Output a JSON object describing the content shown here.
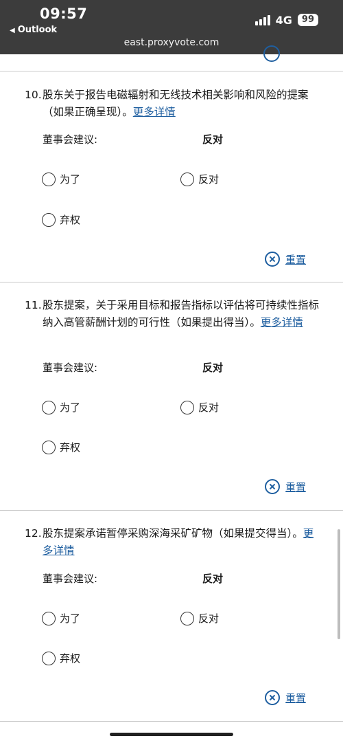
{
  "status": {
    "time": "09:57",
    "back_app": "Outlook",
    "network": "4G",
    "battery": "99",
    "url": "east.proxyvote.com"
  },
  "questions": [
    {
      "number": "10.",
      "text": "股东关于报告电磁辐射和无线技术相关影响和风险的提案（如果正确呈现）。",
      "more": "更多详情",
      "rec_label": "董事会建议:",
      "rec_value": "反对",
      "opt_for": "为了",
      "opt_against": "反对",
      "opt_abstain": "弃权",
      "reset": "重置"
    },
    {
      "number": "11.",
      "text": "股东提案，关于采用目标和报告指标以评估将可持续性指标纳入高管薪酬计划的可行性（如果提出得当）。",
      "more": "更多详情",
      "rec_label": "董事会建议:",
      "rec_value": "反对",
      "opt_for": "为了",
      "opt_against": "反对",
      "opt_abstain": "弃权",
      "reset": "重置"
    },
    {
      "number": "12.",
      "text": "股东提案承诺暂停采购深海采矿矿物（如果提交得当）。",
      "more": "更多详情",
      "rec_label": "董事会建议:",
      "rec_value": "反对",
      "opt_for": "为了",
      "opt_against": "反对",
      "opt_abstain": "弃权",
      "reset": "重置"
    }
  ]
}
